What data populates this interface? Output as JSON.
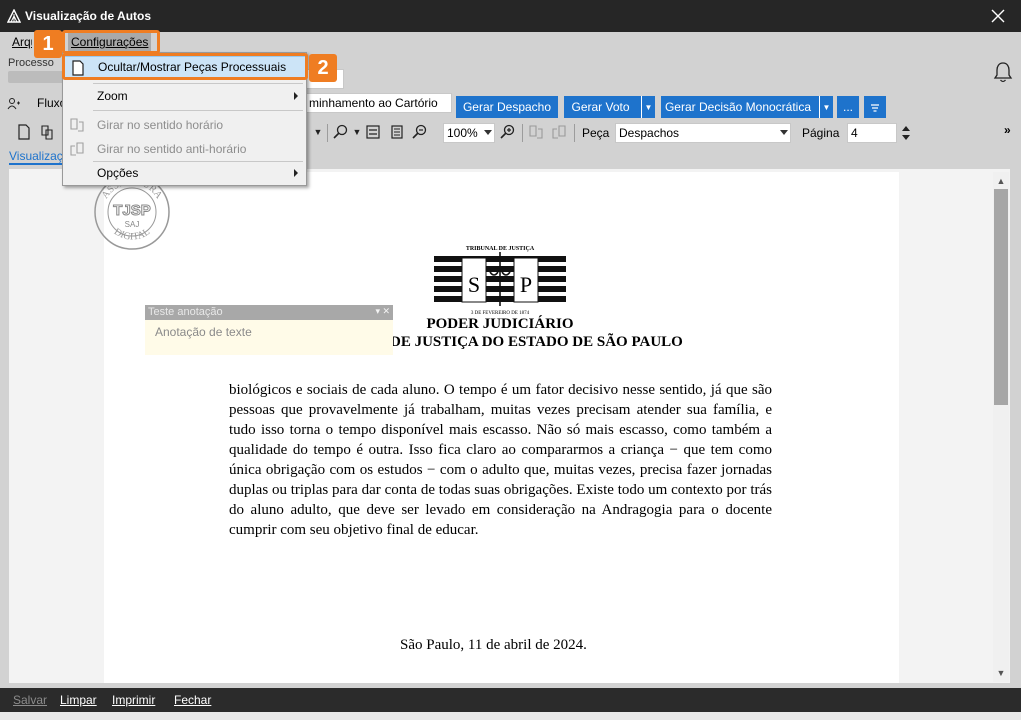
{
  "window": {
    "title": "Visualização de Autos"
  },
  "menubar": {
    "arquivo": "Arquivo",
    "configuracoes": "Configurações"
  },
  "processo": {
    "label": "Processo"
  },
  "acoes": {
    "fluxo": "Fluxo",
    "encaminhamento": "minhamento ao Cartório",
    "gerar_despacho": "Gerar Despacho",
    "gerar_voto": "Gerar Voto",
    "gerar_decisao": "Gerar Decisão Monocrática",
    "mais": "..."
  },
  "toolbar": {
    "zoom_value": "100%",
    "peca_label": "Peça",
    "peca_value": "Despachos",
    "pagina_label": "Página",
    "pagina_value": "4"
  },
  "tabs": {
    "visualizacao": "Visualização"
  },
  "dropdown": {
    "items": [
      {
        "label": "Ocultar/Mostrar Peças Processuais"
      },
      {
        "label": "Zoom"
      },
      {
        "label": "Girar no sentido horário"
      },
      {
        "label": "Girar no sentido anti-horário"
      },
      {
        "label": "Opções"
      }
    ]
  },
  "callouts": {
    "one": "1",
    "two": "2"
  },
  "annotation": {
    "title": "Teste anotação",
    "body": "Anotação de texte"
  },
  "document": {
    "stamp_top": "ASSINATURA",
    "stamp_center": "TJSP",
    "stamp_sub": "SAJ",
    "stamp_bottom": "DIGITAL",
    "emblem_top": "TRIBUNAL DE JUSTIÇA",
    "emblem_left": "S",
    "emblem_right": "P",
    "emblem_bottom": "3 DE FEVEREIRO DE 1874",
    "header1": "PODER JUDICIÁRIO",
    "header2": "DE JUSTIÇA DO ESTADO DE SÃO PAULO",
    "body": "biológicos e sociais de cada aluno. O tempo é um fator decisivo nesse sentido, já que são pessoas que provavelmente já trabalham, muitas vezes precisam atender sua família, e tudo isso torna o tempo disponível mais escasso. Não só mais escasso, como também a qualidade do tempo é outra. Isso fica claro ao compararmos a criança − que tem como única obrigação com os estudos − com o adulto que, muitas vezes, precisa fazer jornadas duplas ou triplas para dar conta de todas suas obrigações. Existe todo um contexto por trás do aluno adulto, que deve ser levado em consideração na Andragogia para o docente cumprir com seu objetivo final de educar.",
    "date": "São Paulo, 11 de abril de 2024."
  },
  "bottombar": {
    "salvar": "Salvar",
    "limpar": "Limpar",
    "imprimir": "Imprimir",
    "fechar": "Fechar"
  },
  "colors": {
    "accent": "#1e73cc",
    "callout": "#ef7d22",
    "titlebar": "#262626"
  }
}
